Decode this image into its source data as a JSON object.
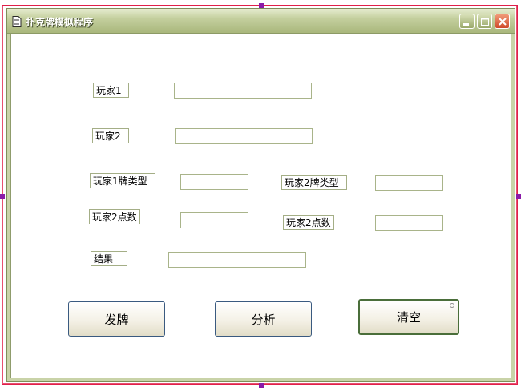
{
  "window": {
    "title": "扑克牌模拟程序",
    "title_icon": "document-icon",
    "controls": [
      "minimize-icon",
      "maximize-icon",
      "close-icon"
    ]
  },
  "form": {
    "player1_label": "玩家1",
    "player1_value": "",
    "player2_label": "玩家2",
    "player2_value": "",
    "player1_type_label": "玩家1牌类型",
    "player1_type_value": "",
    "player2_type_label": "玩家2牌类型",
    "player2_type_value": "",
    "player2_points_label_left": "玩家2点数",
    "player2_points_value_left": "",
    "player2_points_label_right": "玩家2点数",
    "player2_points_value_right": "",
    "result_label": "结果",
    "result_value": ""
  },
  "buttons": {
    "deal": "发牌",
    "analyze": "分析",
    "clear": "清空"
  },
  "colors": {
    "selection_outline": "#e0204a",
    "selection_handle": "#8a1aa8",
    "titlebar": "#b5c28a",
    "close_button": "#d8603a"
  }
}
